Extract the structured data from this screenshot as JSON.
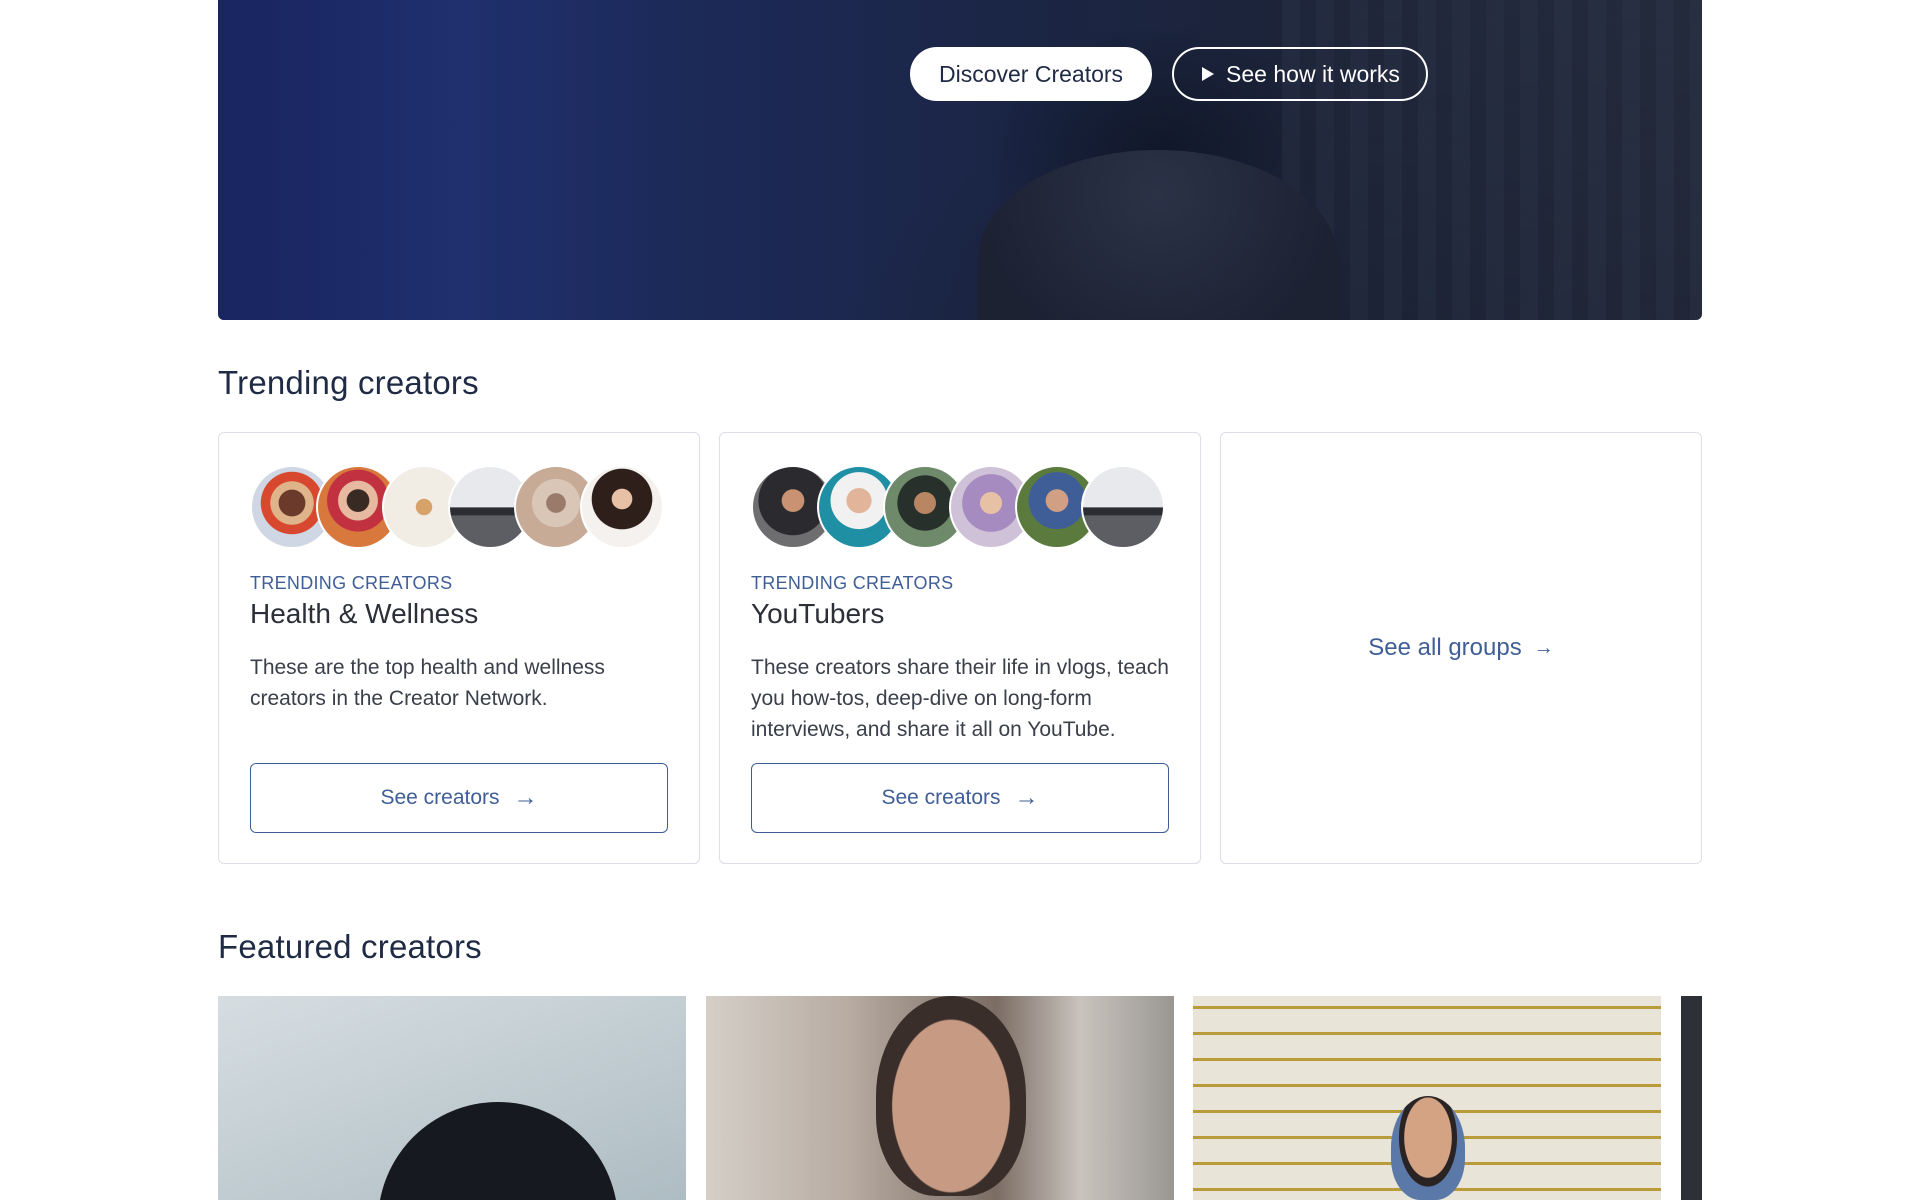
{
  "hero": {
    "primary_button": "Discover Creators",
    "secondary_button": "See how it works",
    "play_icon": "play-icon"
  },
  "trending": {
    "title": "Trending creators",
    "cards": [
      {
        "eyebrow": "TRENDING CREATORS",
        "title": "Health & Wellness",
        "description": "These are the top health and wellness creators in the Creator Network.",
        "cta": "See creators",
        "arrow": "→"
      },
      {
        "eyebrow": "TRENDING CREATORS",
        "title": "YouTubers",
        "description": "These creators share their life in vlogs, teach you how-tos, deep-dive on long-form interviews, and share it all on YouTube.",
        "cta": "See creators",
        "arrow": "→"
      }
    ],
    "see_all": "See all groups",
    "see_all_arrow": "→"
  },
  "featured": {
    "title": "Featured creators"
  },
  "colors": {
    "accent": "#3f5e97",
    "heading": "#1f2a44",
    "border": "#dcdfe5"
  }
}
